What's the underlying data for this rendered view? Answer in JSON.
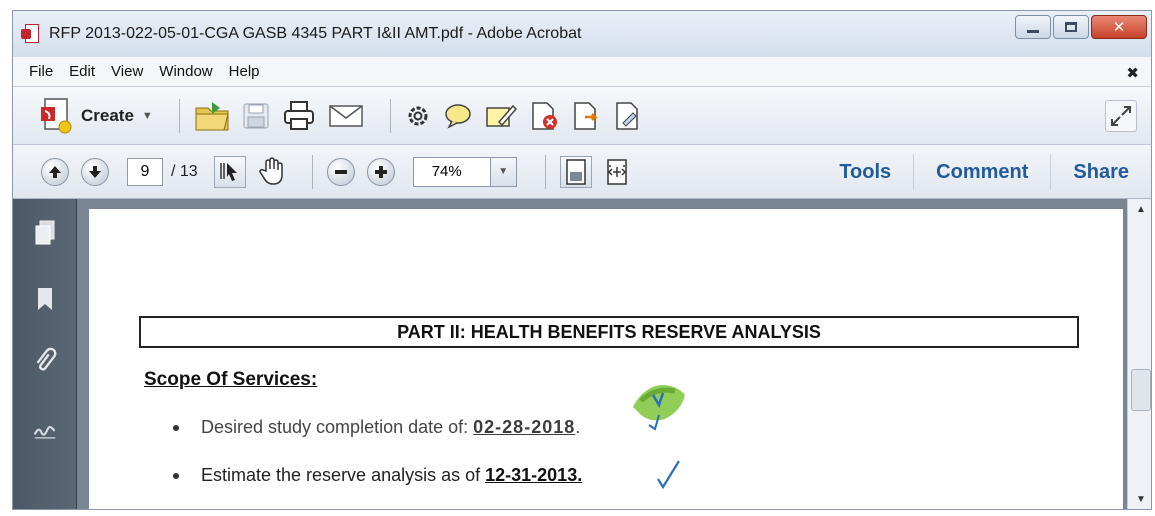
{
  "window": {
    "title": "RFP 2013-022-05-01-CGA GASB 4345 PART I&II AMT.pdf - Adobe Acrobat"
  },
  "menubar": {
    "items": [
      {
        "label": "File"
      },
      {
        "label": "Edit"
      },
      {
        "label": "View"
      },
      {
        "label": "Window"
      },
      {
        "label": "Help"
      }
    ],
    "close_glyph": "✖"
  },
  "toolbar": {
    "create_label": "Create",
    "create_caret": "▼",
    "icons": [
      "open-folder-icon",
      "save-icon",
      "print-icon",
      "email-icon",
      "settings-gear-icon",
      "comment-bubble-icon",
      "sign-pen-icon",
      "delete-page-icon",
      "export-pdf-icon",
      "edit-file-icon"
    ]
  },
  "navigation": {
    "current_page": "9",
    "total_pages": "/ 13",
    "zoom": "74%",
    "zoom_caret": "▼"
  },
  "right_panel_tabs": [
    {
      "label": "Tools"
    },
    {
      "label": "Comment"
    },
    {
      "label": "Share"
    }
  ],
  "document": {
    "section_heading": "PART II:   HEALTH BENEFITS RESERVE ANALYSIS",
    "subheading": "Scope Of Services:",
    "bullets": [
      {
        "prefix": "Desired study completion date of:  ",
        "value": "02-28-2018",
        "suffix": "."
      },
      {
        "prefix": "Estimate the reserve analysis as of ",
        "value": "12-31-2013.",
        "suffix": ""
      }
    ]
  },
  "colors": {
    "tab_text": "#235a9a",
    "rail_background": "#4c5866",
    "check_mark": "#2a6fb8",
    "highlight_green": "#7fc53a"
  },
  "scrollbar": {
    "up_arrow": "▲",
    "down_arrow": "▼"
  }
}
